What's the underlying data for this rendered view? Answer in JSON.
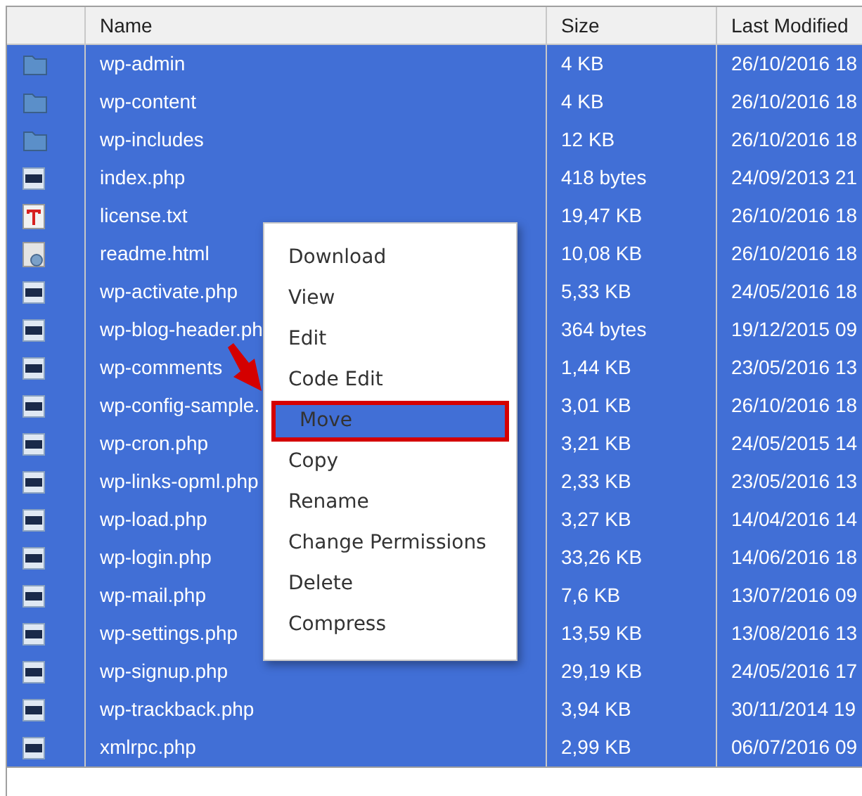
{
  "table": {
    "columns": [
      {
        "label": "Name"
      },
      {
        "label": "Size"
      },
      {
        "label": "Last Modified"
      }
    ],
    "rows": [
      {
        "kind": "folder",
        "name": "wp-admin",
        "size": "4 KB",
        "modified": "26/10/2016 18",
        "selected": true
      },
      {
        "kind": "folder",
        "name": "wp-content",
        "size": "4 KB",
        "modified": "26/10/2016 18",
        "selected": true
      },
      {
        "kind": "folder",
        "name": "wp-includes",
        "size": "12 KB",
        "modified": "26/10/2016 18",
        "selected": true
      },
      {
        "kind": "php",
        "name": "index.php",
        "size": "418 bytes",
        "modified": "24/09/2013 21",
        "selected": true
      },
      {
        "kind": "text",
        "name": "license.txt",
        "size": "19,47 KB",
        "modified": "26/10/2016 18",
        "selected": true
      },
      {
        "kind": "html",
        "name": "readme.html",
        "size": "10,08 KB",
        "modified": "26/10/2016 18",
        "selected": true
      },
      {
        "kind": "php",
        "name": "wp-activate.php",
        "size": "5,33 KB",
        "modified": "24/05/2016 18",
        "selected": true
      },
      {
        "kind": "php",
        "name": "wp-blog-header.ph",
        "size": "364 bytes",
        "modified": "19/12/2015 09",
        "selected": true
      },
      {
        "kind": "php",
        "name": "wp-comments",
        "size": "1,44 KB",
        "modified": "23/05/2016 13",
        "selected": true
      },
      {
        "kind": "php",
        "name": "wp-config-sample.",
        "size": "3,01 KB",
        "modified": "26/10/2016 18",
        "selected": true
      },
      {
        "kind": "php",
        "name": "wp-cron.php",
        "size": "3,21 KB",
        "modified": "24/05/2015 14",
        "selected": true
      },
      {
        "kind": "php",
        "name": "wp-links-opml.php",
        "size": "2,33 KB",
        "modified": "23/05/2016 13",
        "selected": true
      },
      {
        "kind": "php",
        "name": "wp-load.php",
        "size": "3,27 KB",
        "modified": "14/04/2016 14",
        "selected": true
      },
      {
        "kind": "php",
        "name": "wp-login.php",
        "size": "33,26 KB",
        "modified": "14/06/2016 18",
        "selected": true
      },
      {
        "kind": "php",
        "name": "wp-mail.php",
        "size": "7,6 KB",
        "modified": "13/07/2016 09",
        "selected": true
      },
      {
        "kind": "php",
        "name": "wp-settings.php",
        "size": "13,59 KB",
        "modified": "13/08/2016 13",
        "selected": true
      },
      {
        "kind": "php",
        "name": "wp-signup.php",
        "size": "29,19 KB",
        "modified": "24/05/2016 17",
        "selected": true
      },
      {
        "kind": "php",
        "name": "wp-trackback.php",
        "size": "3,94 KB",
        "modified": "30/11/2014 19",
        "selected": true
      },
      {
        "kind": "php",
        "name": "xmlrpc.php",
        "size": "2,99 KB",
        "modified": "06/07/2016 09",
        "selected": true
      }
    ]
  },
  "context_menu": {
    "items": [
      {
        "label": "Download",
        "selected": false
      },
      {
        "label": "View",
        "selected": false
      },
      {
        "label": "Edit",
        "selected": false
      },
      {
        "label": "Code Edit",
        "selected": false
      },
      {
        "label": "Move",
        "selected": true
      },
      {
        "label": "Copy",
        "selected": false
      },
      {
        "label": "Rename",
        "selected": false
      },
      {
        "label": "Change Permissions",
        "selected": false
      },
      {
        "label": "Delete",
        "selected": false
      },
      {
        "label": "Compress",
        "selected": false
      }
    ]
  }
}
